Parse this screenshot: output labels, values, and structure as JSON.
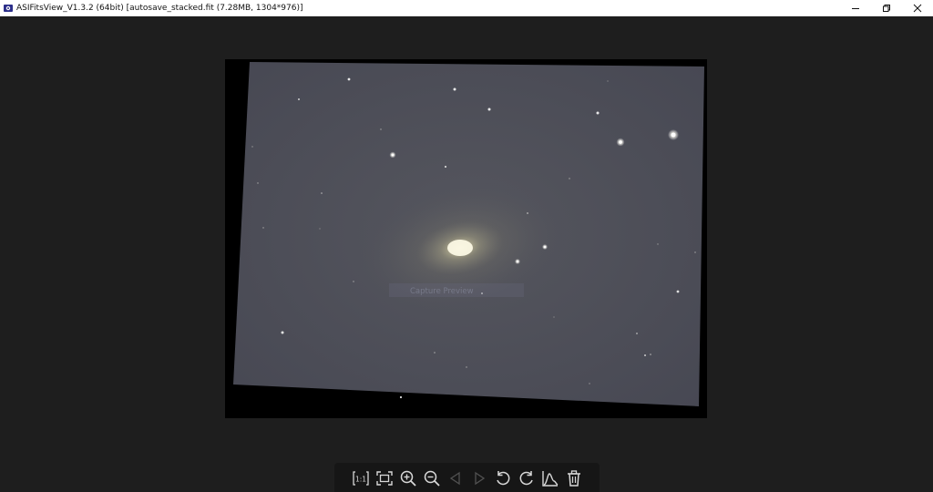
{
  "window": {
    "title": "ASIFitsView_V1.3.2 (64bit) [autosave_stacked.fit (7.28MB, 1304*976)]",
    "controls": [
      "minimize-icon",
      "restore-icon",
      "close-icon"
    ]
  },
  "viewer": {
    "overlay_label": "Capture Preview",
    "colors": {
      "background": "#1e1e1e",
      "sky": "#4a4b55",
      "toolbar": "#161616",
      "icon": "#d8d8d8"
    }
  },
  "toolbar": {
    "buttons": [
      {
        "icon": "actual-size-icon",
        "label": "1:1",
        "enabled": true
      },
      {
        "icon": "fit-window-icon",
        "enabled": true
      },
      {
        "icon": "zoom-in-icon",
        "enabled": true
      },
      {
        "icon": "zoom-out-icon",
        "enabled": true
      },
      {
        "icon": "previous-icon",
        "enabled": false
      },
      {
        "icon": "next-icon",
        "enabled": false
      },
      {
        "icon": "rotate-left-icon",
        "enabled": true
      },
      {
        "icon": "rotate-right-icon",
        "enabled": true
      },
      {
        "icon": "histogram-icon",
        "enabled": true
      },
      {
        "icon": "delete-icon",
        "enabled": true
      }
    ]
  }
}
